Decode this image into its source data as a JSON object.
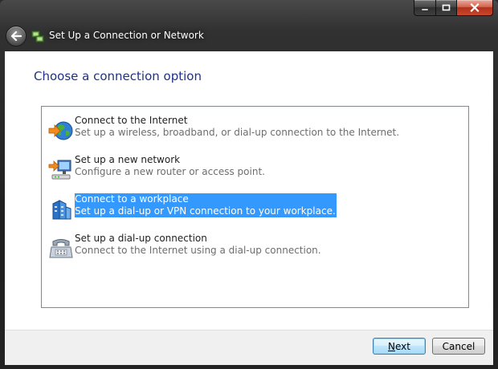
{
  "window": {
    "title": "Set Up a Connection or Network"
  },
  "content": {
    "heading": "Choose a connection option",
    "options": [
      {
        "title": "Connect to the Internet",
        "description": "Set up a wireless, broadband, or dial-up connection to the Internet.",
        "icon": "globe-icon",
        "selected": false
      },
      {
        "title": "Set up a new network",
        "description": "Configure a new router or access point.",
        "icon": "network-icon",
        "selected": false
      },
      {
        "title": "Connect to a workplace",
        "description": "Set up a dial-up or VPN connection to your workplace.",
        "icon": "workplace-icon",
        "selected": true
      },
      {
        "title": "Set up a dial-up connection",
        "description": "Connect to the Internet using a dial-up connection.",
        "icon": "phone-icon",
        "selected": false
      }
    ]
  },
  "footer": {
    "next_mnemonic": "N",
    "next_rest": "ext",
    "cancel_label": "Cancel"
  },
  "colors": {
    "heading": "#1e3287",
    "selection": "#3399ff",
    "close_button": "#c9472b"
  }
}
